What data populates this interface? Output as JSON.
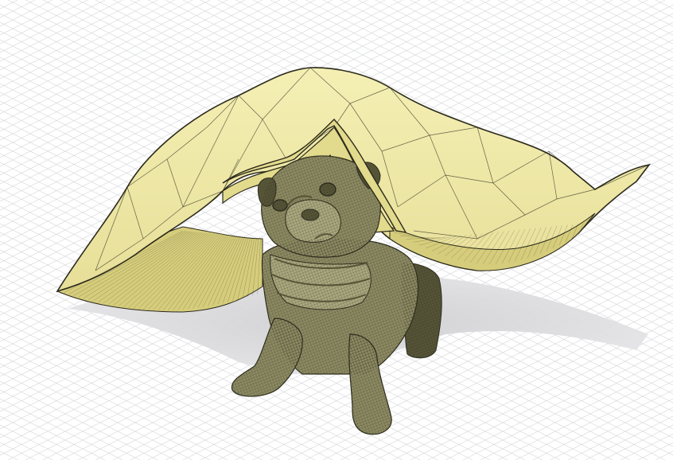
{
  "viewport": {
    "background": "#ffffff",
    "grid_color": "#d7d8db",
    "shadow_color": "#d3d3d5"
  },
  "canopy": {
    "fill": "#efe9a6",
    "fill_dark": "#e2da8c",
    "fill_shade": "#d6cd7c",
    "edge_color": "#2b2a1c"
  },
  "figure": {
    "fill": "#8c8a62",
    "fill_light": "#aaa87e",
    "fill_dark": "#555437",
    "wire_color": "#2e2d1e"
  }
}
